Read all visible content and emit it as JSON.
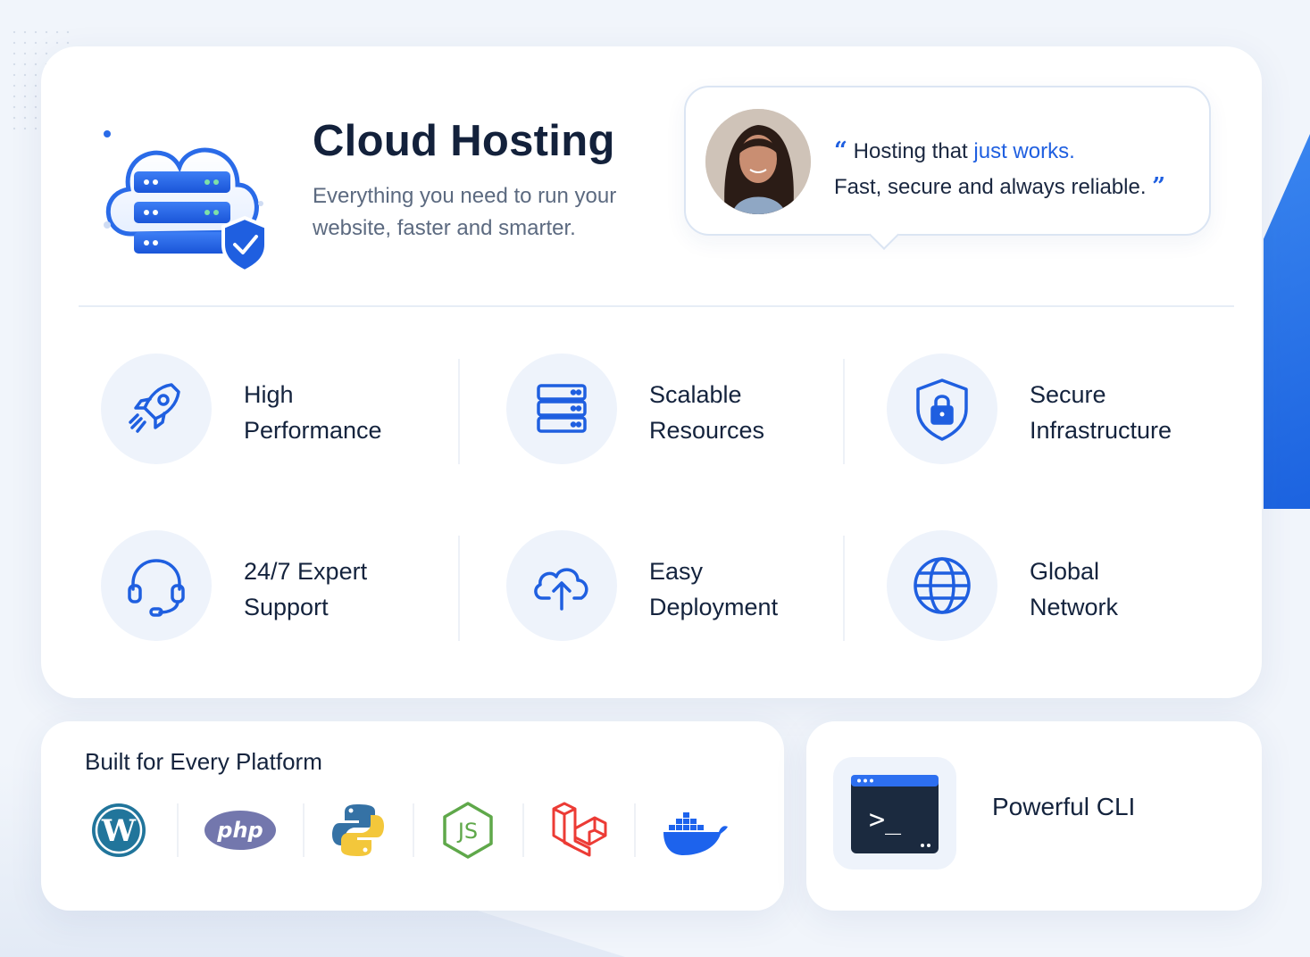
{
  "hero": {
    "title": "Cloud Hosting",
    "subtitle": "Everything you need to run your website, faster and smarter."
  },
  "testimonial": {
    "line1_prefix": "Hosting that ",
    "line1_accent": "just works.",
    "line2": "Fast, secure and always reliable.",
    "open_quote": "“",
    "close_quote": "”"
  },
  "features": [
    {
      "icon": "rocket-icon",
      "line1": "High",
      "line2": "Performance"
    },
    {
      "icon": "server-stack-icon",
      "line1": "Scalable",
      "line2": "Resources"
    },
    {
      "icon": "shield-lock-icon",
      "line1": "Secure",
      "line2": "Infrastructure"
    },
    {
      "icon": "headset-icon",
      "line1": "24/7 Expert",
      "line2": "Support"
    },
    {
      "icon": "cloud-upload-icon",
      "line1": "Easy",
      "line2": "Deployment"
    },
    {
      "icon": "globe-icon",
      "line1": "Global",
      "line2": "Network"
    }
  ],
  "platforms": {
    "title": "Built for Every Platform",
    "logos": [
      {
        "icon": "wordpress-logo",
        "text": "W"
      },
      {
        "icon": "php-logo",
        "text": "php"
      },
      {
        "icon": "python-logo",
        "text": ""
      },
      {
        "icon": "nodejs-logo",
        "text": "JS"
      },
      {
        "icon": "laravel-logo",
        "text": ""
      },
      {
        "icon": "docker-logo",
        "text": ""
      }
    ]
  },
  "cli": {
    "label": "Powerful CLI",
    "prompt": ">_"
  },
  "colors": {
    "accent": "#1f5fe0",
    "text": "#14233d",
    "muted": "#5c6a80",
    "icon_bg": "#eef3fb"
  }
}
